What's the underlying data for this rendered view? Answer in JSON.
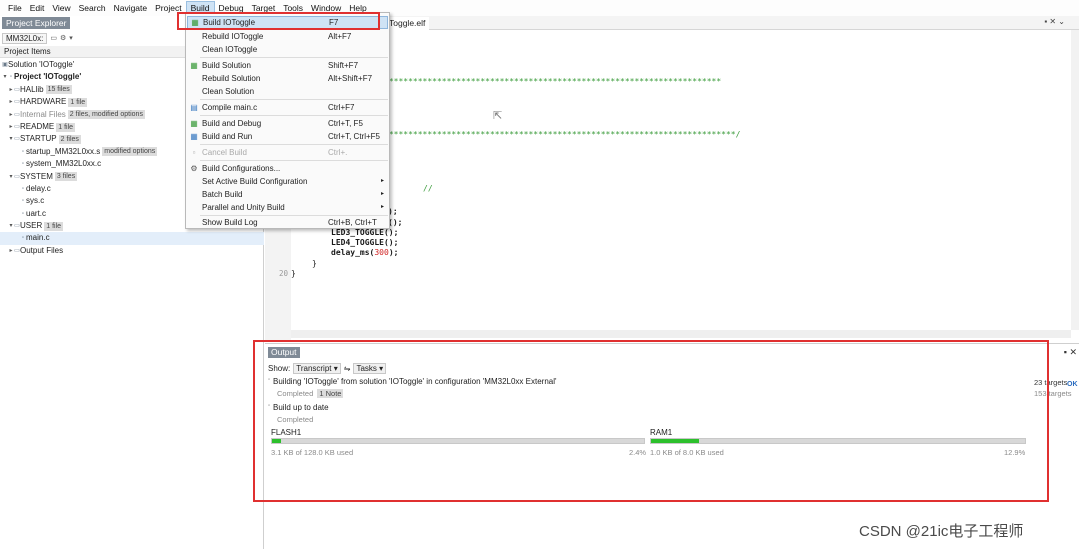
{
  "menubar": {
    "items": [
      "File",
      "Edit",
      "View",
      "Search",
      "Navigate",
      "Project",
      "Build",
      "Debug",
      "Target",
      "Tools",
      "Window",
      "Help"
    ],
    "active": "Build"
  },
  "project_explorer": {
    "title": "Project Explorer",
    "combo": "MM32L0x:",
    "header": "Project Items",
    "tree": [
      {
        "label": "Solution 'IOToggle'",
        "badge": ""
      },
      {
        "label": "Project 'IOToggle'",
        "badge": ""
      },
      {
        "label": "HALlib",
        "badge": "15 files"
      },
      {
        "label": "HARDWARE",
        "badge": "1 file"
      },
      {
        "label": "Internal Files",
        "badge": "2 files, modified options"
      },
      {
        "label": "README",
        "badge": "1 file"
      },
      {
        "label": "STARTUP",
        "badge": "2 files"
      },
      {
        "label": "startup_MM32L0xx.s",
        "badge": "modified options"
      },
      {
        "label": "system_MM32L0xx.c",
        "badge": ""
      },
      {
        "label": "SYSTEM",
        "badge": "3 files"
      },
      {
        "label": "delay.c",
        "badge": ""
      },
      {
        "label": "sys.c",
        "badge": ""
      },
      {
        "label": "uart.c",
        "badge": ""
      },
      {
        "label": "USER",
        "badge": "1 file"
      },
      {
        "label": "main.c",
        "badge": ""
      },
      {
        "label": "Output Files",
        "badge": ""
      }
    ]
  },
  "build_menu": {
    "items": [
      {
        "label": "Build IOToggle",
        "key": "F7"
      },
      {
        "label": "Rebuild IOToggle",
        "key": "Alt+F7"
      },
      {
        "label": "Clean IOToggle",
        "key": ""
      },
      {
        "label": "Build Solution",
        "key": "Shift+F7"
      },
      {
        "label": "Rebuild Solution",
        "key": "Alt+Shift+F7"
      },
      {
        "label": "Clean Solution",
        "key": ""
      },
      {
        "label": "Compile main.c",
        "key": "Ctrl+F7"
      },
      {
        "label": "Build and Debug",
        "key": "Ctrl+T, F5"
      },
      {
        "label": "Build and Run",
        "key": "Ctrl+T, Ctrl+F5"
      },
      {
        "label": "Cancel Build",
        "key": "Ctrl+."
      },
      {
        "label": "Build Configurations...",
        "key": ""
      },
      {
        "label": "Set Active Build Configuration",
        "key": ""
      },
      {
        "label": "Batch Build",
        "key": ""
      },
      {
        "label": "Parallel and Unity Build",
        "key": ""
      },
      {
        "label": "Show Build Log",
        "key": "Ctrl+B, Ctrl+T"
      }
    ]
  },
  "editor": {
    "tab": "Toggle.elf",
    "stars_line_1": "**********************************************************************",
    "stars_line_2": "*************************************************************************/",
    "comment": "//",
    "frag_1": ");",
    "frag_2": "();",
    "led3": "LED3_TOGGLE();",
    "led4": "LED4_TOGGLE();",
    "delay_prefix": "delay_ms(",
    "delay_value": "300",
    "delay_suffix": ");",
    "close_inner": "}",
    "close_outer": "}",
    "line_number": "20"
  },
  "output": {
    "title": "Output",
    "show_label": "Show:",
    "show_value": "Transcript",
    "tasks_value": "Tasks",
    "msg1": "Building 'IOToggle' from solution 'IOToggle' in configuration 'MM32L0xx External'",
    "msg1_status": "Completed",
    "msg1_note": "1 Note",
    "msg2": "Build up to date",
    "msg2_status": "Completed",
    "targets": "23 targets",
    "targets2": "153 targets",
    "ok": "OK",
    "flash": {
      "label": "FLASH1",
      "used": "3.1 KB of 128.0 KB used",
      "percent": "2.4%",
      "fraction": 0.024
    },
    "ram": {
      "label": "RAM1",
      "used": "1.0 KB of 8.0 KB used",
      "percent": "12.9%",
      "fraction": 0.129
    }
  },
  "watermark": "CSDN @21ic电子工程师",
  "colors": {
    "highlight_border": "#e03030",
    "progress_fill": "#2cc02c",
    "menu_highlight": "#cfe3f5"
  }
}
